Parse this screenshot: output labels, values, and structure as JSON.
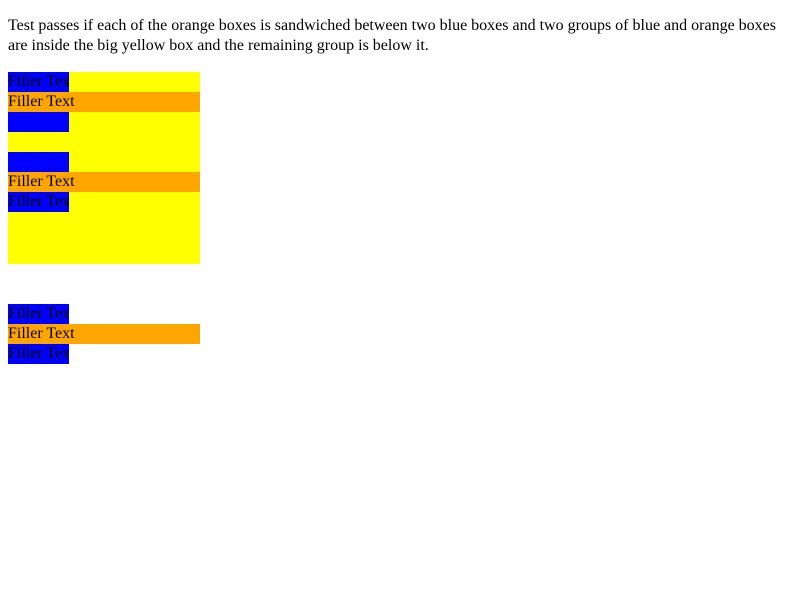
{
  "instructions": "Test passes if each of the orange boxes is sandwiched between two blue boxes and two groups of blue and orange boxes are inside the big yellow box and the remaining group is below it.",
  "groups": {
    "inside_first": {
      "top_blue": "Filler Text",
      "orange": "Filler Text",
      "bottom_blue": ""
    },
    "inside_second": {
      "top_blue": "",
      "orange": "Filler Text",
      "bottom_blue": "Filler Text"
    },
    "below": {
      "top_blue": "Filler Text",
      "orange": "Filler Text",
      "bottom_blue": "Filler Text"
    }
  },
  "colors": {
    "yellow": "#ffff00",
    "blue": "#0000ff",
    "orange": "#ffa500"
  }
}
